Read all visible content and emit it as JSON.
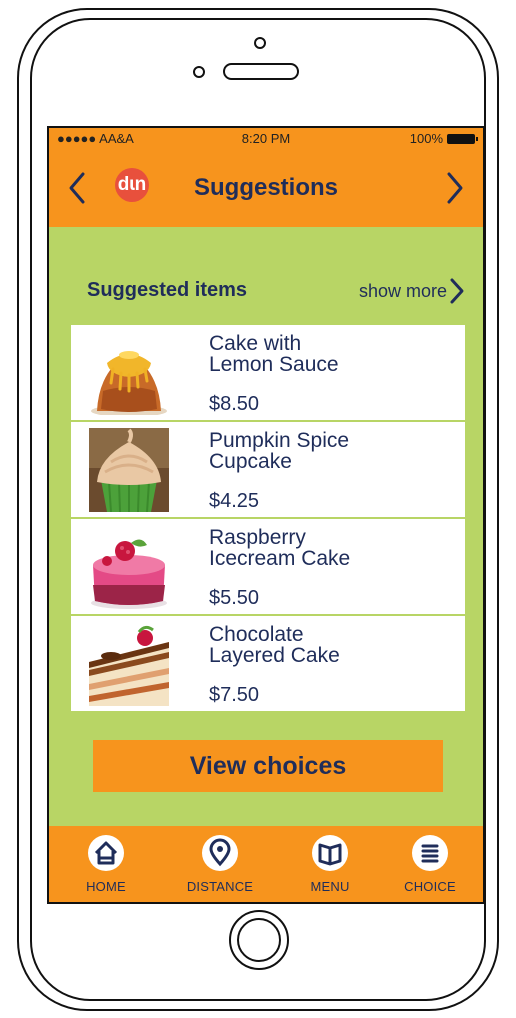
{
  "status_bar": {
    "carrier": "●●●●● AA&A",
    "time": "8:20 PM",
    "battery": "100%"
  },
  "header": {
    "title": "Suggestions",
    "logo_text": "dɩn"
  },
  "section": {
    "title": "Suggested items",
    "show_more_label": "show more"
  },
  "items": [
    {
      "name_line1": "Cake with",
      "name_line2": "Lemon Sauce",
      "price": "$8.50"
    },
    {
      "name_line1": "Pumpkin Spice",
      "name_line2": "Cupcake",
      "price": "$4.25"
    },
    {
      "name_line1": "Raspberry",
      "name_line2": "Icecream Cake",
      "price": "$5.50"
    },
    {
      "name_line1": "Chocolate",
      "name_line2": "Layered Cake",
      "price": "$7.50"
    }
  ],
  "cta": {
    "label": "View choices"
  },
  "tabs": [
    {
      "label": "HOME",
      "icon": "home-icon"
    },
    {
      "label": "DISTANCE",
      "icon": "location-pin-icon"
    },
    {
      "label": "MENU",
      "icon": "book-icon"
    },
    {
      "label": "CHOICE",
      "icon": "list-icon"
    }
  ],
  "colors": {
    "accent": "#f7941d",
    "screen_bg": "#b8d565",
    "text_navy": "#1f2d5a",
    "logo_red": "#e8503c"
  }
}
